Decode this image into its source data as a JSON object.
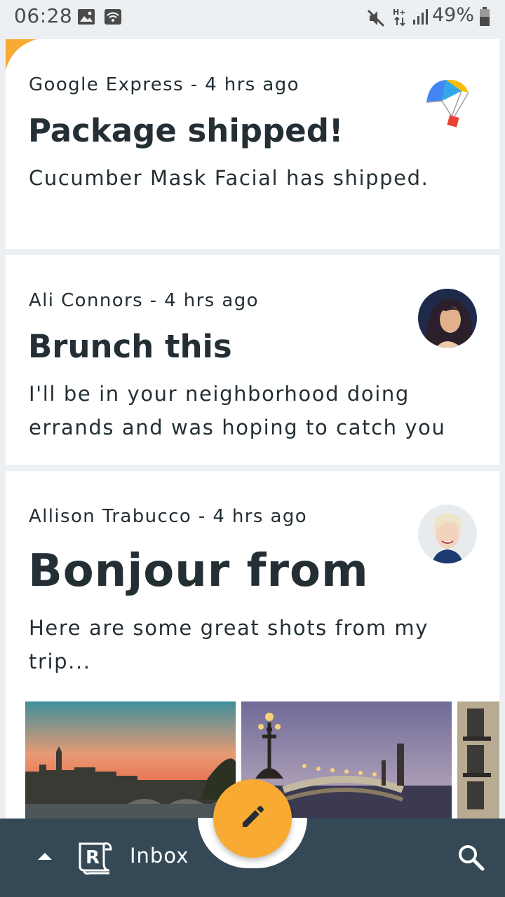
{
  "status_bar": {
    "time": "06:28",
    "network": "H+",
    "battery": "49%",
    "icons": [
      "image-icon",
      "wifi-icon",
      "mute-icon",
      "network-h-plus-icon",
      "signal-icon",
      "battery-icon"
    ]
  },
  "emails": [
    {
      "meta": "Google Express - 4 hrs ago",
      "subject": "Package shipped!",
      "preview": "Cucumber Mask Facial has shipped.",
      "avatar_icon": "parachute-icon"
    },
    {
      "meta": "Ali Connors - 4 hrs ago",
      "subject": "Brunch this",
      "preview": "I'll be in your neighborhood doing errands and was hoping to catch you",
      "avatar_icon": "avatar-photo"
    },
    {
      "meta": "Allison Trabucco - 4 hrs ago",
      "subject": "Bonjour from",
      "preview": "Here are some great shots from my trip...",
      "avatar_icon": "avatar-photo",
      "attachments": [
        "paris-sunset-photo",
        "paris-bridge-photo",
        "paris-building-photo"
      ]
    }
  ],
  "bottom_nav": {
    "label": "Inbox",
    "icons": [
      "expand-up-icon",
      "reply-logo-icon",
      "search-icon"
    ]
  },
  "fab": {
    "icon": "edit-icon"
  },
  "colors": {
    "accent": "#f9aa33",
    "bar": "#344955",
    "text": "#232f34",
    "background": "#edf0f2"
  }
}
